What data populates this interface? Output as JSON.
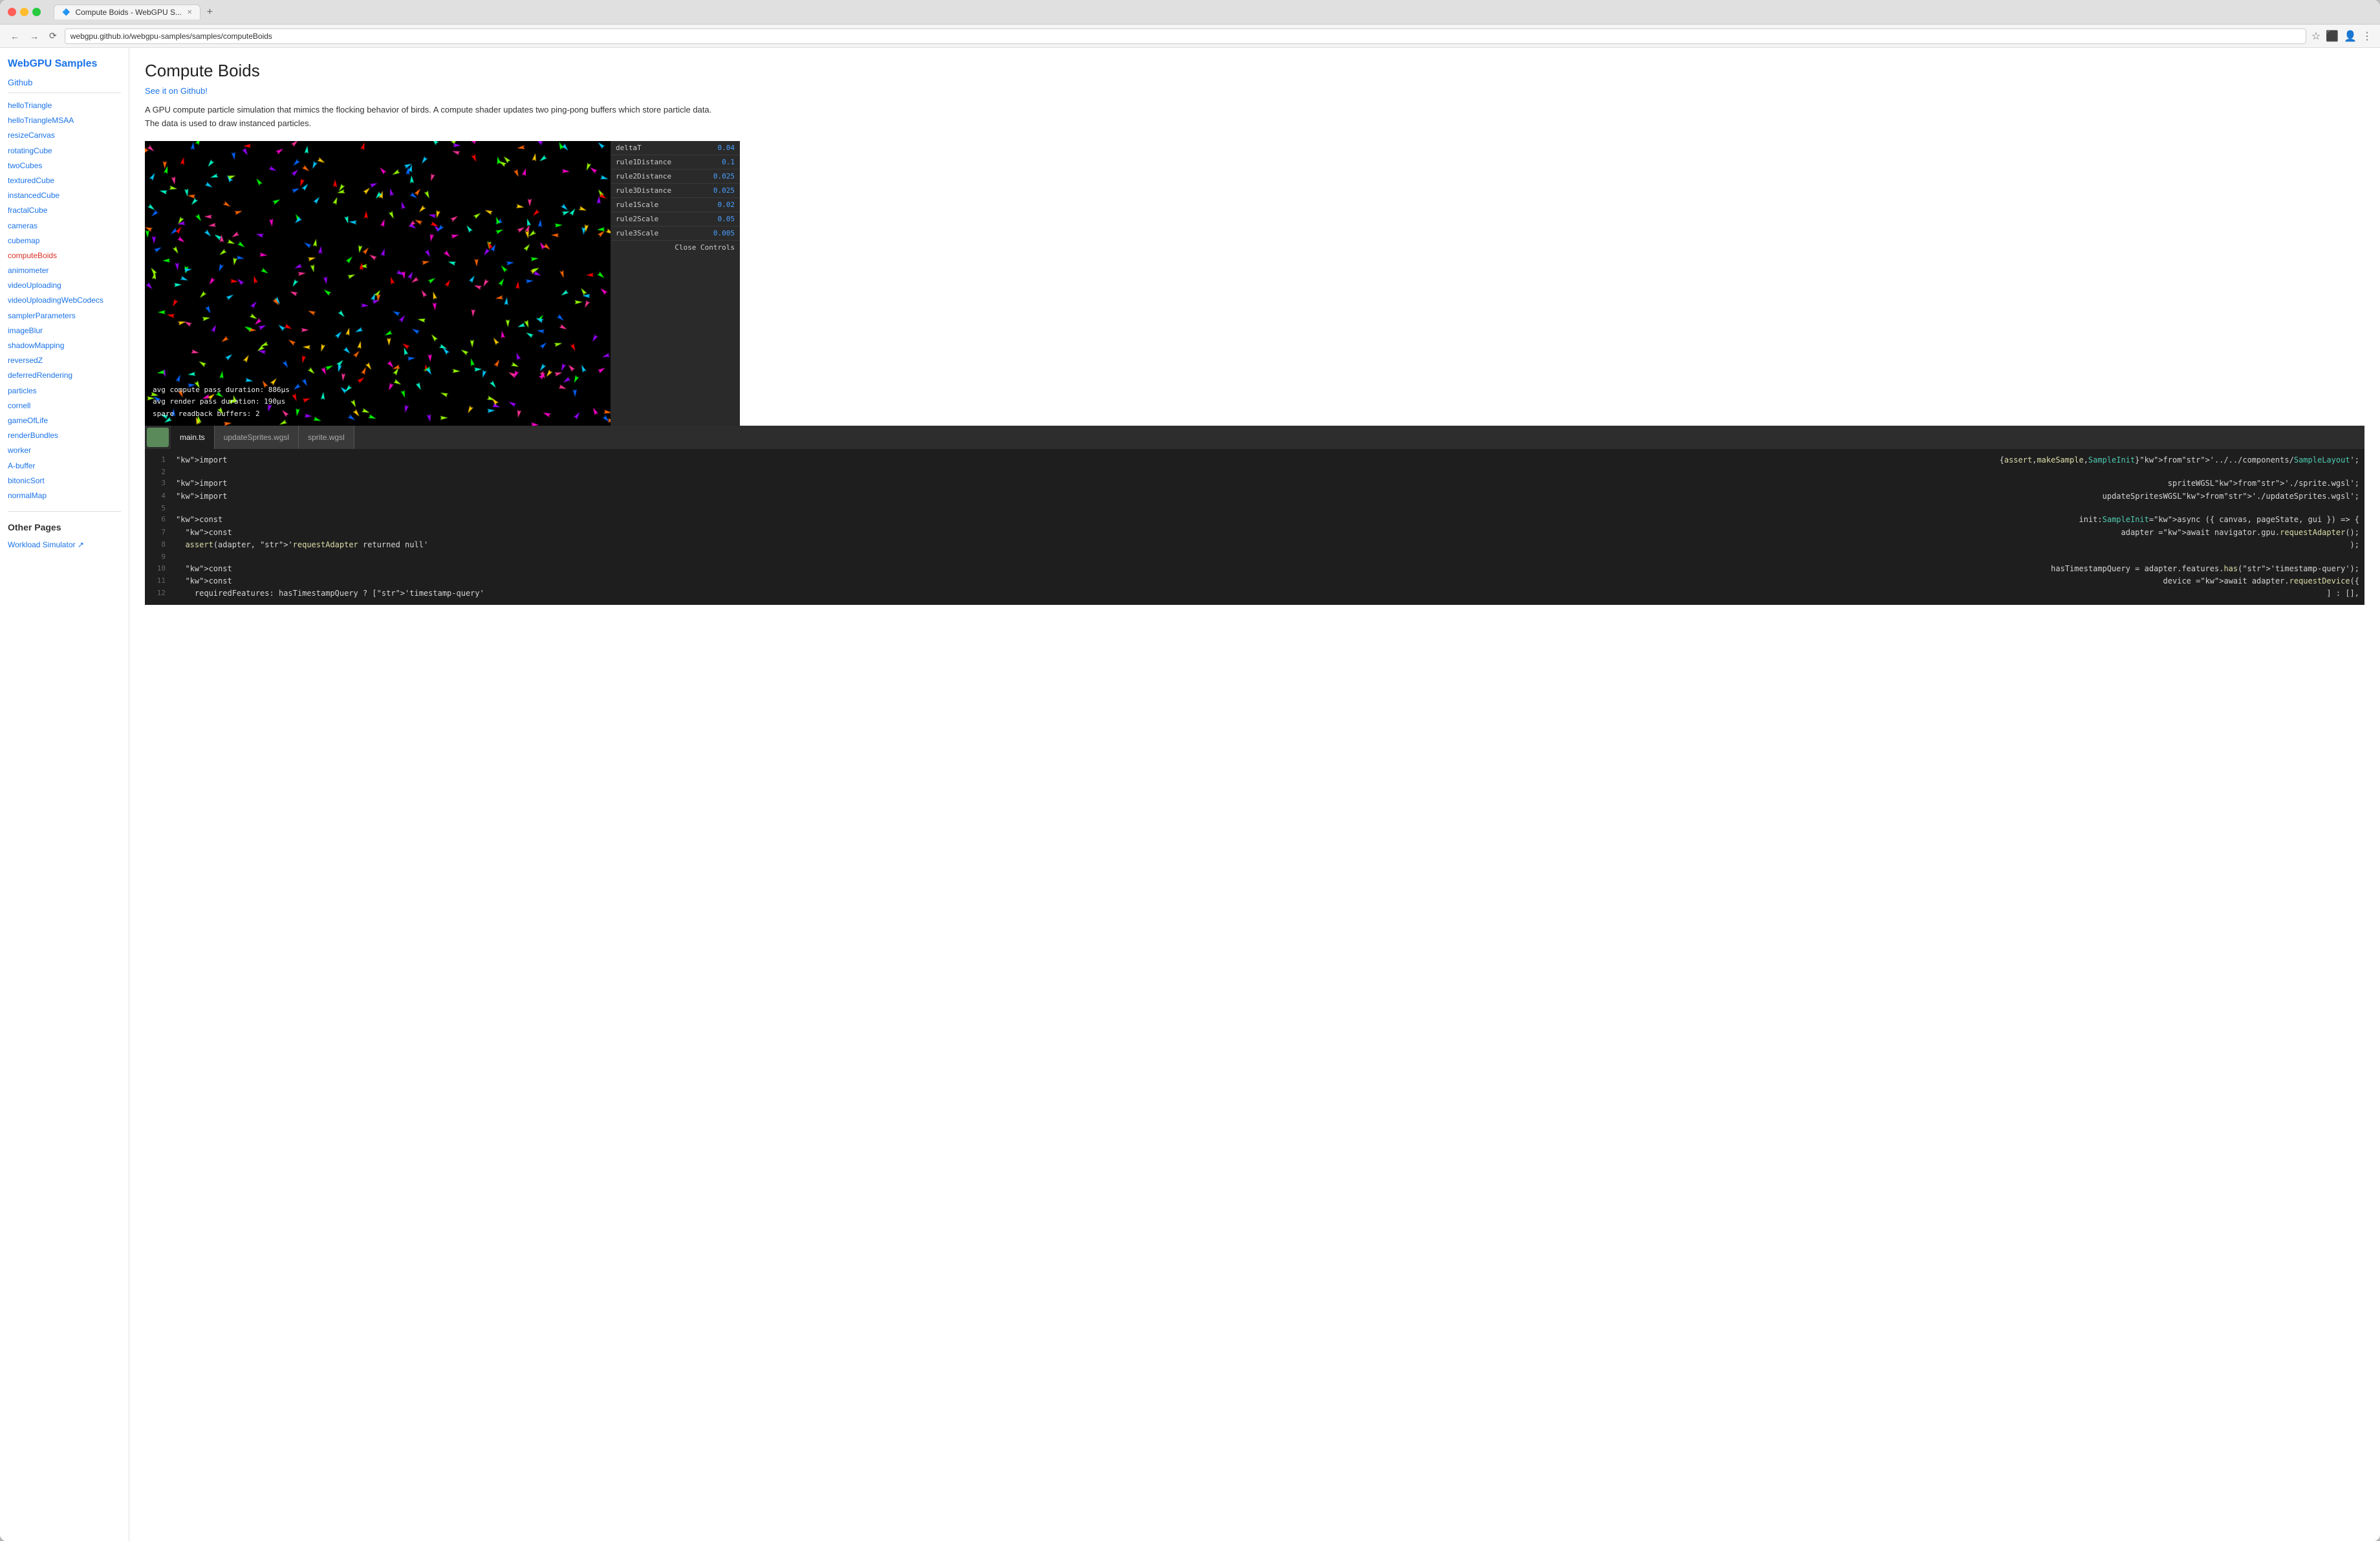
{
  "browser": {
    "tab_title": "Compute Boids - WebGPU S...",
    "url": "webgpu.github.io/webgpu-samples/samples/computeBoids",
    "new_tab_label": "+"
  },
  "sidebar": {
    "title": "WebGPU Samples",
    "github_label": "Github",
    "nav_items": [
      {
        "label": "helloTriangle",
        "active": false
      },
      {
        "label": "helloTriangleMSAA",
        "active": false
      },
      {
        "label": "resizeCanvas",
        "active": false
      },
      {
        "label": "rotatingCube",
        "active": false
      },
      {
        "label": "twoCubes",
        "active": false
      },
      {
        "label": "texturedCube",
        "active": false
      },
      {
        "label": "instancedCube",
        "active": false
      },
      {
        "label": "fractalCube",
        "active": false
      },
      {
        "label": "cameras",
        "active": false
      },
      {
        "label": "cubemap",
        "active": false
      },
      {
        "label": "computeBoids",
        "active": true
      },
      {
        "label": "animometer",
        "active": false
      },
      {
        "label": "videoUploading",
        "active": false
      },
      {
        "label": "videoUploadingWebCodecs",
        "active": false
      },
      {
        "label": "samplerParameters",
        "active": false
      },
      {
        "label": "imageBlur",
        "active": false
      },
      {
        "label": "shadowMapping",
        "active": false
      },
      {
        "label": "reversedZ",
        "active": false
      },
      {
        "label": "deferredRendering",
        "active": false
      },
      {
        "label": "particles",
        "active": false
      },
      {
        "label": "cornell",
        "active": false
      },
      {
        "label": "gameOfLife",
        "active": false
      },
      {
        "label": "renderBundles",
        "active": false
      },
      {
        "label": "worker",
        "active": false
      },
      {
        "label": "A-buffer",
        "active": false
      },
      {
        "label": "bitonicSort",
        "active": false
      },
      {
        "label": "normalMap",
        "active": false
      }
    ],
    "other_pages_title": "Other Pages",
    "other_pages": [
      {
        "label": "Workload Simulator ↗"
      }
    ]
  },
  "main": {
    "page_title": "Compute Boids",
    "github_link": "See it on Github!",
    "description": "A GPU compute particle simulation that mimics the flocking behavior of birds. A compute shader updates two ping-pong buffers which store particle data. The data is used to draw instanced particles.",
    "stats": {
      "compute_pass": "avg compute pass duration:  886µs",
      "render_pass": "avg render pass duration:   190µs",
      "spare_readback": "spare readback buffers:      2"
    },
    "controls": {
      "title": "Controls",
      "close_label": "Close Controls",
      "fields": [
        {
          "label": "deltaT",
          "value": "0.04"
        },
        {
          "label": "rule1Distance",
          "value": "0.1"
        },
        {
          "label": "rule2Distance",
          "value": "0.025"
        },
        {
          "label": "rule3Distance",
          "value": "0.025"
        },
        {
          "label": "rule1Scale",
          "value": "0.02"
        },
        {
          "label": "rule2Scale",
          "value": "0.05"
        },
        {
          "label": "rule3Scale",
          "value": "0.005"
        }
      ]
    },
    "code_tabs": [
      {
        "label": "main.ts",
        "active": true
      },
      {
        "label": "updateSprites.wgsl",
        "active": false
      },
      {
        "label": "sprite.wgsl",
        "active": false
      }
    ],
    "code_lines": [
      {
        "num": 1,
        "content": "import { assert, makeSample, SampleInit } from '../../components/SampleLayout';"
      },
      {
        "num": 2,
        "content": ""
      },
      {
        "num": 3,
        "content": "import spriteWGSL from './sprite.wgsl';"
      },
      {
        "num": 4,
        "content": "import updateSpritesWGSL from './updateSprites.wgsl';"
      },
      {
        "num": 5,
        "content": ""
      },
      {
        "num": 6,
        "content": "const init: SampleInit = async ({ canvas, pageState, gui }) => {"
      },
      {
        "num": 7,
        "content": "  const adapter = await navigator.gpu.requestAdapter();"
      },
      {
        "num": 8,
        "content": "  assert(adapter, 'requestAdapter returned null');"
      },
      {
        "num": 9,
        "content": ""
      },
      {
        "num": 10,
        "content": "  const hasTimestampQuery = adapter.features.has('timestamp-query');"
      },
      {
        "num": 11,
        "content": "  const device = await adapter.requestDevice({"
      },
      {
        "num": 12,
        "content": "    requiredFeatures: hasTimestampQuery ? ['timestamp-query'] : [],"
      }
    ]
  }
}
